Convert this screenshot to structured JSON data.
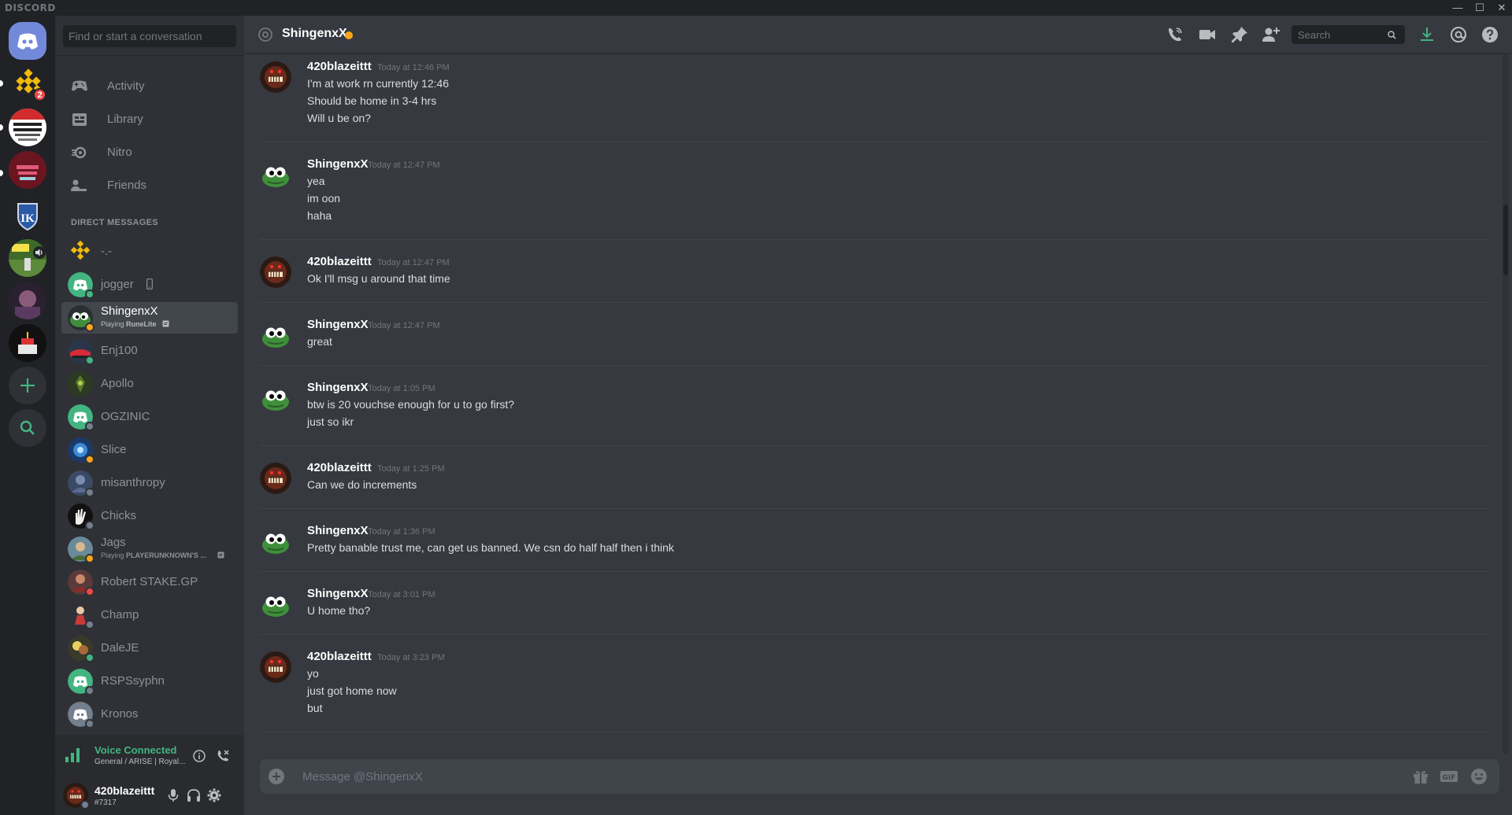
{
  "window": {
    "brand": "DISCORD",
    "minimize": "—",
    "maximize": "☐",
    "close": "✕"
  },
  "servers": {
    "binance_badge": "2"
  },
  "sidebar": {
    "search_placeholder": "Find or start a conversation",
    "nav": [
      {
        "label": "Activity",
        "icon": "gamepad-icon"
      },
      {
        "label": "Library",
        "icon": "library-icon"
      },
      {
        "label": "Nitro",
        "icon": "nitro-icon"
      },
      {
        "label": "Friends",
        "icon": "friends-icon"
      }
    ],
    "dm_header": "DIRECT MESSAGES",
    "dms": [
      {
        "name": "-.-",
        "status": "none"
      },
      {
        "name": "jogger",
        "status": "online"
      },
      {
        "name": "ShingenxX",
        "sub_prefix": "Playing ",
        "sub_game": "RuneLite",
        "status": "idle",
        "active": true
      },
      {
        "name": "Enj100",
        "status": "online"
      },
      {
        "name": "Apollo",
        "status": "none"
      },
      {
        "name": "OGZINIC",
        "status": "off"
      },
      {
        "name": "Slice",
        "status": "idle"
      },
      {
        "name": "misanthropy",
        "status": "off"
      },
      {
        "name": "Chicks",
        "status": "off"
      },
      {
        "name": "Jags",
        "sub_prefix": "Playing ",
        "sub_game": "PLAYERUNKNOWN'S ...",
        "status": "idle"
      },
      {
        "name": "Robert STAKE.GP",
        "status": "dnd"
      },
      {
        "name": "Champ",
        "status": "off"
      },
      {
        "name": "DaleJE",
        "status": "online"
      },
      {
        "name": "RSPSsyphn",
        "status": "off"
      },
      {
        "name": "Kronos",
        "status": "off"
      }
    ]
  },
  "voice": {
    "status": "Voice Connected",
    "channel": "General / ARISE | Royal..."
  },
  "user": {
    "name": "420blazeittt",
    "tag": "#7317"
  },
  "chat": {
    "title": "ShingenxX",
    "search_placeholder": "Search",
    "composer_placeholder": "Message @ShingenxX",
    "messages": [
      {
        "author": "420blazeittt",
        "time": "Today at 12:46 PM",
        "lines": [
          "I'm at work rn currently 12:46",
          "Should be home in 3-4 hrs",
          "Will u be on?"
        ]
      },
      {
        "author": "ShingenxX",
        "time": "Today at 12:47 PM",
        "lines": [
          "yea",
          "im oon",
          "haha"
        ]
      },
      {
        "author": "420blazeittt",
        "time": "Today at 12:47 PM",
        "lines": [
          "Ok I'll msg u around that time"
        ]
      },
      {
        "author": "ShingenxX",
        "time": "Today at 12:47 PM",
        "lines": [
          "great"
        ]
      },
      {
        "author": "ShingenxX",
        "time": "Today at 1:05 PM",
        "lines": [
          "btw is 20 vouchse enough for u to go first?",
          "just so ikr"
        ]
      },
      {
        "author": "420blazeittt",
        "time": "Today at 1:25 PM",
        "lines": [
          "Can we do increments"
        ]
      },
      {
        "author": "ShingenxX",
        "time": "Today at 1:36 PM",
        "lines": [
          "Pretty banable trust me, can get us banned. We csn do half half then i think"
        ]
      },
      {
        "author": "ShingenxX",
        "time": "Today at 3:01 PM",
        "lines": [
          "U home tho?"
        ]
      },
      {
        "author": "420blazeittt",
        "time": "Today at 3:23 PM",
        "lines": [
          "yo",
          "just got home now",
          "but"
        ]
      }
    ]
  },
  "colors": {
    "accent": "#7289da",
    "online": "#43b581",
    "idle": "#faa61a",
    "dnd": "#f04747",
    "offline": "#747f8d"
  }
}
